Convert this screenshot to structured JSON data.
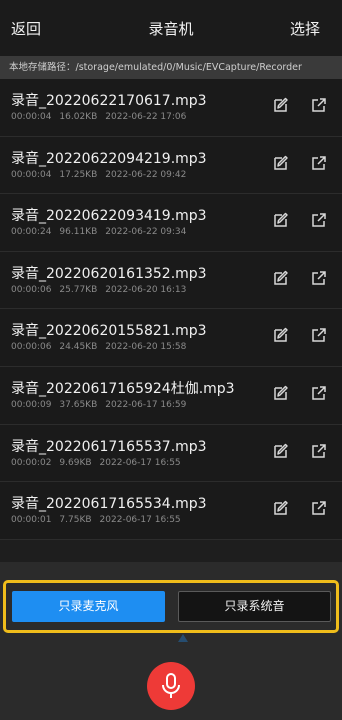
{
  "header": {
    "back_label": "返回",
    "title": "录音机",
    "select_label": "选择"
  },
  "storage_path": "本地存储路径：/storage/emulated/0/Music/EVCapture/Recorder",
  "recordings": [
    {
      "name": "录音_20220622170617.mp3",
      "duration": "00:00:04",
      "size": "16.02KB",
      "date": "2022-06-22 17:06"
    },
    {
      "name": "录音_20220622094219.mp3",
      "duration": "00:00:04",
      "size": "17.25KB",
      "date": "2022-06-22 09:42"
    },
    {
      "name": "录音_20220622093419.mp3",
      "duration": "00:00:24",
      "size": "96.11KB",
      "date": "2022-06-22 09:34"
    },
    {
      "name": "录音_20220620161352.mp3",
      "duration": "00:00:06",
      "size": "25.77KB",
      "date": "2022-06-20 16:13"
    },
    {
      "name": "录音_20220620155821.mp3",
      "duration": "00:00:06",
      "size": "24.45KB",
      "date": "2022-06-20 15:58"
    },
    {
      "name": "录音_20220617165924杜伽.mp3",
      "duration": "00:00:09",
      "size": "37.65KB",
      "date": "2022-06-17 16:59"
    },
    {
      "name": "录音_20220617165537.mp3",
      "duration": "00:00:02",
      "size": "9.69KB",
      "date": "2022-06-17 16:55"
    },
    {
      "name": "录音_20220617165534.mp3",
      "duration": "00:00:01",
      "size": "7.75KB",
      "date": "2022-06-17 16:55"
    }
  ],
  "modes": {
    "mic_only": "只录麦克风",
    "system_only": "只录系统音"
  },
  "icons": {
    "edit": "edit-icon",
    "share": "share-icon",
    "record": "microphone-icon"
  },
  "colors": {
    "accent_blue": "#1e8ef2",
    "record_red": "#ee3a37",
    "highlight_yellow": "#f0bd1b"
  }
}
